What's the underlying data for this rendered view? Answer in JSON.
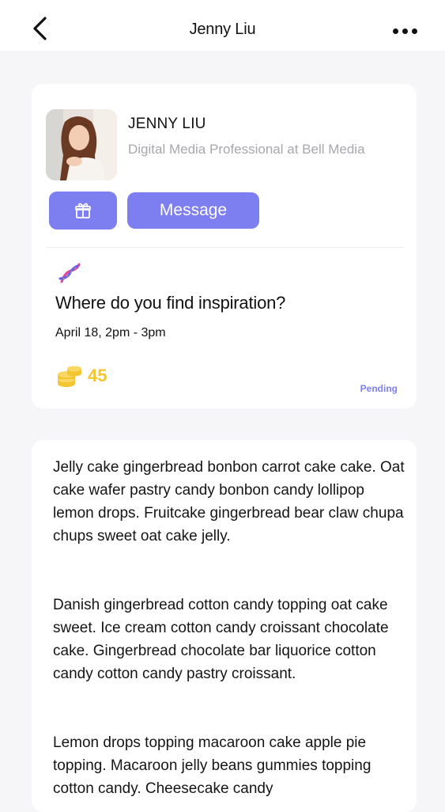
{
  "header": {
    "title": "Jenny Liu",
    "back_icon": "chevron-left-icon",
    "more_icon": "more-horizontal-icon"
  },
  "profile": {
    "name": "JENNY LIU",
    "role": "Digital Media Professional at Bell Media",
    "message_label": "Message",
    "gift_icon": "gift-icon"
  },
  "event": {
    "icon": "dna-icon",
    "title": "Where do you find inspiration?",
    "time": "April 18, 2pm - 3pm",
    "coins": "45",
    "coins_icon": "coins-icon",
    "status": "Pending"
  },
  "content": {
    "paragraphs": [
      "Jelly cake gingerbread bonbon carrot cake cake. Oat cake wafer pastry candy bonbon candy lollipop lemon drops. Fruitcake gingerbread bear claw chupa chups sweet oat cake jelly.",
      "Danish gingerbread cotton candy topping oat cake sweet. Ice cream cotton candy croissant chocolate cake. Gingerbread chocolate bar liquorice cotton candy cotton candy pastry croissant.",
      "Lemon drops topping macaroon cake apple pie topping. Macaroon jelly beans gummies topping cotton candy. Cheesecake candy"
    ]
  },
  "colors": {
    "accent": "#7d7ef0",
    "coins": "#f3c531",
    "muted_text": "#a7a7ad",
    "background": "#f6f6f8"
  }
}
